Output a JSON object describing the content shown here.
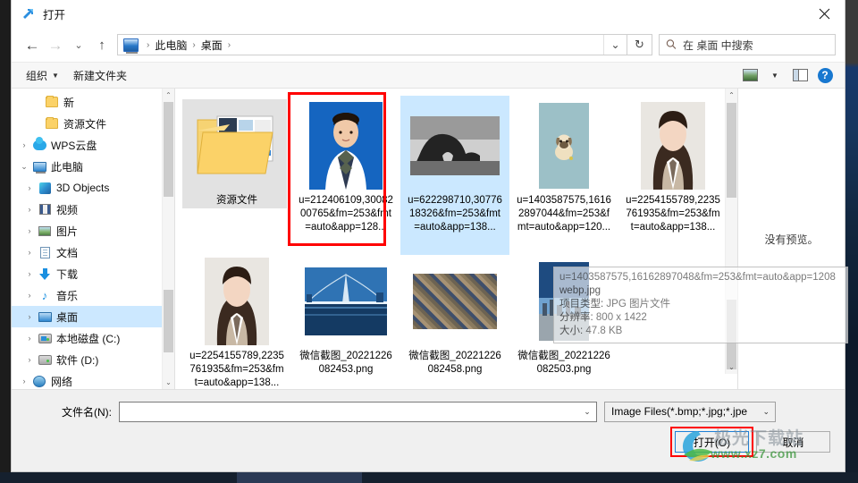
{
  "window": {
    "title": "打开",
    "title_icon": "open-file-icon",
    "close_label": "✕"
  },
  "nav": {
    "back_icon": "arrow-left-icon",
    "forward_icon": "arrow-right-icon",
    "recent_icon": "chevron-down-icon",
    "up_icon": "arrow-up-icon",
    "address_icon": "this-pc-icon",
    "breadcrumbs": [
      "此电脑",
      "桌面"
    ],
    "separator": "›",
    "dropdown_icon": "chevron-down-icon",
    "refresh_icon": "refresh-icon",
    "refresh_glyph": "↻"
  },
  "search": {
    "icon": "search-icon",
    "placeholder": "在 桌面 中搜索"
  },
  "toolbar": {
    "organize_label": "组织",
    "organize_caret": "▼",
    "new_folder_label": "新建文件夹",
    "view_icon": "view-layout-icon",
    "view_caret": "▼",
    "preview_pane_icon": "preview-pane-icon",
    "help_icon": "help-icon",
    "help_glyph": "?"
  },
  "sidebar": {
    "scroll_up": "⌃",
    "scroll_down": "⌄",
    "items": [
      {
        "label": "新",
        "icon": "folder-icon",
        "expander": "",
        "indent": 1,
        "selected": false
      },
      {
        "label": "资源文件",
        "icon": "folder-icon",
        "expander": "",
        "indent": 1,
        "selected": false
      },
      {
        "label": "WPS云盘",
        "icon": "cloud-icon",
        "expander": "›",
        "indent": 0,
        "selected": false
      },
      {
        "label": "此电脑",
        "icon": "this-pc-icon",
        "expander": "⌄",
        "indent": 0,
        "selected": false
      },
      {
        "label": "3D Objects",
        "icon": "cube-icon",
        "expander": "›",
        "indent": 1,
        "selected": false
      },
      {
        "label": "视频",
        "icon": "video-icon",
        "expander": "›",
        "indent": 1,
        "selected": false
      },
      {
        "label": "图片",
        "icon": "pictures-icon",
        "expander": "›",
        "indent": 1,
        "selected": false
      },
      {
        "label": "文档",
        "icon": "documents-icon",
        "expander": "›",
        "indent": 1,
        "selected": false
      },
      {
        "label": "下载",
        "icon": "downloads-icon",
        "expander": "›",
        "indent": 1,
        "selected": false
      },
      {
        "label": "音乐",
        "icon": "music-icon",
        "expander": "›",
        "indent": 1,
        "selected": false
      },
      {
        "label": "桌面",
        "icon": "desktop-icon",
        "expander": "›",
        "indent": 1,
        "selected": true
      },
      {
        "label": "本地磁盘 (C:)",
        "icon": "local-disk-icon",
        "expander": "›",
        "indent": 1,
        "selected": false
      },
      {
        "label": "软件 (D:)",
        "icon": "disk-icon",
        "expander": "›",
        "indent": 1,
        "selected": false
      },
      {
        "label": "网络",
        "icon": "network-icon",
        "expander": "›",
        "indent": 0,
        "selected": false
      }
    ]
  },
  "files": {
    "rows": [
      [
        {
          "name": "资源文件",
          "kind": "folder",
          "thumb": "folder-thumb",
          "state": "selected-grey"
        },
        {
          "name": "u=212406109,3008200765&fm=253&fmt=auto&app=128...",
          "kind": "image",
          "thumb": "id-photo-thumb",
          "state": "red-highlight"
        },
        {
          "name": "u=622298710,3077618326&fm=253&fmt=auto&app=138...",
          "kind": "image",
          "thumb": "rock-thumb",
          "state": "selected-blue"
        },
        {
          "name": "u=1403587575,16162897044&fm=253&fmt=auto&app=120...",
          "kind": "image",
          "thumb": "pug-thumb",
          "state": "normal"
        },
        {
          "name": "u=2254155789,2235761935&fm=253&fmt=auto&app=138...",
          "kind": "image",
          "thumb": "girl-thumb",
          "state": "normal"
        }
      ],
      [
        {
          "name": "u=2254155789,2235761935&fm=253&fmt=auto&app=138...",
          "kind": "image",
          "thumb": "girl-thumb",
          "state": "normal"
        },
        {
          "name": "微信截图_20221226082453.png",
          "kind": "image",
          "thumb": "bridge-thumb",
          "state": "normal"
        },
        {
          "name": "微信截图_20221226082458.png",
          "kind": "image",
          "thumb": "city-thumb",
          "state": "normal"
        },
        {
          "name": "微信截图_20221226082503.png",
          "kind": "image",
          "thumb": "sky-thumb",
          "state": "normal"
        }
      ]
    ],
    "scroll_up": "⌃",
    "scroll_down": "⌄",
    "hscroll_caret": "⌄"
  },
  "tooltip": {
    "line1": "u=1403587575,16162897048&fm=253&fmt=auto&app=1208",
    "line2": "webp.jpg",
    "line3_key": "项目类型:",
    "line3_val": "JPG 图片文件",
    "line4_key": "分辨率:",
    "line4_val": "800 x 1422",
    "line5_key": "大小:",
    "line5_val": "47.8 KB"
  },
  "preview": {
    "message": "没有预览。"
  },
  "bottom": {
    "filename_label": "文件名(N):",
    "filename_value": "",
    "filename_caret": "⌄",
    "filetype_value": "Image Files(*.bmp;*.jpg;*.jpe",
    "filetype_caret": "⌄",
    "open_label": "打开(O)",
    "cancel_label": "取消"
  },
  "watermark": {
    "text": "极光下载站",
    "url": "www.xz7.com"
  },
  "colors": {
    "accent": "#1e7fd6",
    "selection": "#cce8ff",
    "highlight_red": "#ff0000",
    "toolbar_bg": "#f7f7f7",
    "dialog_bg": "#f0f0f0"
  }
}
